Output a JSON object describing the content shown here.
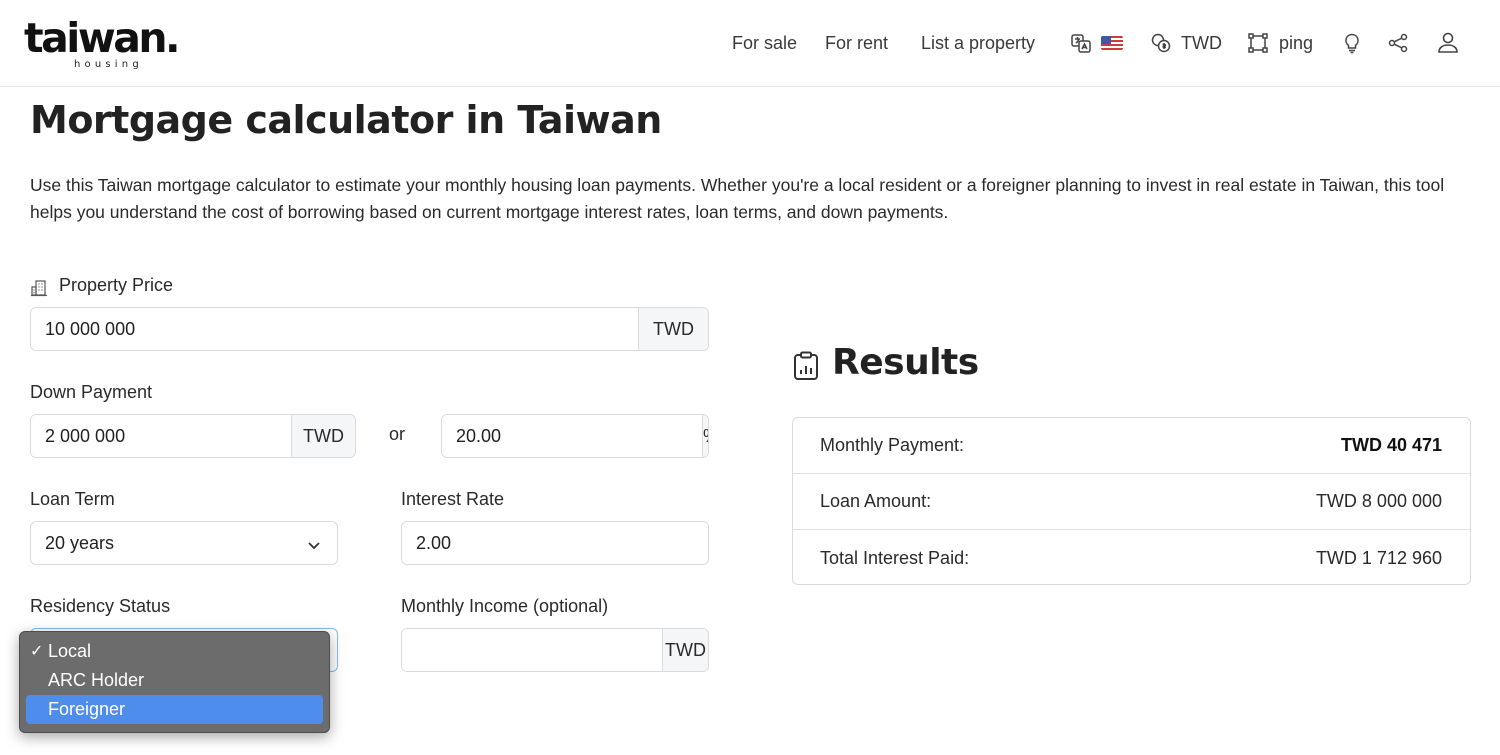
{
  "header": {
    "logo_text": "taiwan.",
    "logo_subtext": "housing",
    "nav": {
      "for_sale": "For sale",
      "for_rent": "For rent",
      "list_property": "List a property",
      "currency": "TWD",
      "ping": "ping"
    },
    "icons": [
      "translate-icon",
      "us-flag-icon",
      "currency-icon",
      "area-unit-icon",
      "lightbulb-icon",
      "share-icon",
      "user-icon"
    ]
  },
  "page": {
    "title": "Mortgage calculator in Taiwan",
    "intro": "Use this Taiwan mortgage calculator to estimate your monthly housing loan payments. Whether you're a local resident or a foreigner planning to invest in real estate in Taiwan, this tool helps you understand the cost of borrowing based on current mortgage interest rates, loan terms, and down payments."
  },
  "form": {
    "property_price": {
      "label": "Property Price",
      "value": "10 000 000",
      "unit": "TWD"
    },
    "down_payment": {
      "label": "Down Payment",
      "value": "2 000 000",
      "unit": "TWD",
      "or": "or",
      "percent_value": "20.00",
      "percent_unit": "%"
    },
    "loan_term": {
      "label": "Loan Term",
      "value": "20 years"
    },
    "interest_rate": {
      "label": "Interest Rate",
      "value": "2.00"
    },
    "residency_status": {
      "label": "Residency Status",
      "options": [
        {
          "label": "Local",
          "checked": true,
          "highlighted": false
        },
        {
          "label": "ARC Holder",
          "checked": false,
          "highlighted": false
        },
        {
          "label": "Foreigner",
          "checked": false,
          "highlighted": true
        }
      ],
      "check_mark": "✓"
    },
    "monthly_income": {
      "label": "Monthly Income (optional)",
      "value": "",
      "unit": "TWD"
    }
  },
  "results": {
    "title": "Results",
    "rows": [
      {
        "label": "Monthly Payment:",
        "value": "TWD 40 471",
        "bold": true
      },
      {
        "label": "Loan Amount:",
        "value": "TWD 8 000 000",
        "bold": false
      },
      {
        "label": "Total Interest Paid:",
        "value": "TWD 1 712 960",
        "bold": false
      }
    ]
  },
  "colors": {
    "dropdown_bg": "#6c6c6c",
    "dropdown_highlight": "#4f8ded",
    "border": "#d8dbe0"
  }
}
